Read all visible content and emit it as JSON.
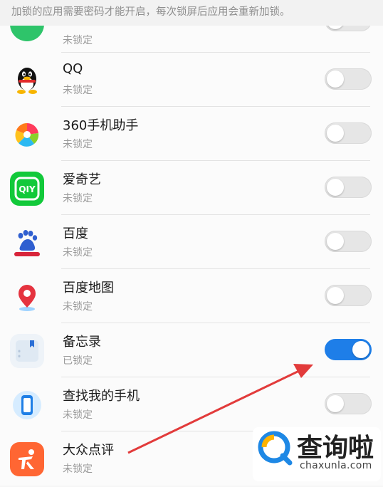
{
  "header": {
    "notice": "加锁的应用需要密码才能开启，每次锁屏后应用会重新加锁。"
  },
  "apps": [
    {
      "name": "",
      "status": "未锁定",
      "locked": false,
      "icon": "green-app-icon"
    },
    {
      "name": "QQ",
      "status": "未锁定",
      "locked": false,
      "icon": "qq-penguin-icon"
    },
    {
      "name": "360手机助手",
      "status": "未锁定",
      "locked": false,
      "icon": "360-assistant-icon"
    },
    {
      "name": "爱奇艺",
      "status": "未锁定",
      "locked": false,
      "icon": "iqiyi-icon"
    },
    {
      "name": "百度",
      "status": "未锁定",
      "locked": false,
      "icon": "baidu-paw-icon"
    },
    {
      "name": "百度地图",
      "status": "未锁定",
      "locked": false,
      "icon": "baidu-map-pin-icon"
    },
    {
      "name": "备忘录",
      "status": "已锁定",
      "locked": true,
      "icon": "notes-icon"
    },
    {
      "name": "查找我的手机",
      "status": "未锁定",
      "locked": false,
      "icon": "find-my-phone-icon"
    },
    {
      "name": "大众点评",
      "status": "未锁定",
      "locked": false,
      "icon": "dianping-icon"
    }
  ],
  "watermark": {
    "name": "查询啦",
    "url": "chaxunla.com"
  },
  "colors": {
    "toggle_on": "#1e7ee8",
    "arrow": "#e23b3b"
  }
}
